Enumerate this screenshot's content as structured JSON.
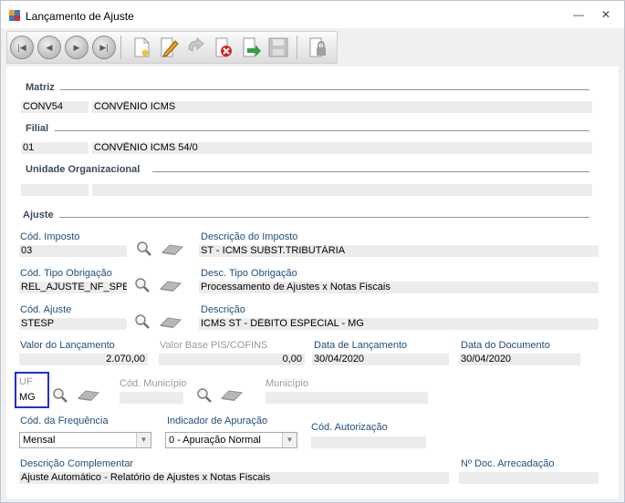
{
  "window": {
    "title": "Lançamento de Ajuste",
    "minimize": "—",
    "close": "✕"
  },
  "toolbar": {
    "buttons": [
      "first-icon",
      "previous-icon",
      "next-icon",
      "last-icon",
      "new-icon",
      "edit-icon",
      "undo-icon",
      "delete-icon",
      "confirm-icon",
      "save-icon",
      "lock-icon"
    ]
  },
  "matriz": {
    "section": "Matriz",
    "code": "CONV54",
    "name": "CONVÊNIO ICMS"
  },
  "filial": {
    "section": "Filial",
    "code": "01",
    "name": "CONVÊNIO ICMS 54/0"
  },
  "unidade": {
    "section": "Unidade Organizacional",
    "code": "",
    "name": ""
  },
  "ajuste": {
    "section": "Ajuste",
    "cod_imposto_label": "Cód. Imposto",
    "cod_imposto": "03",
    "desc_imposto_label": "Descrição do Imposto",
    "desc_imposto": "ST - ICMS SUBST.TRIBUTÁRIA",
    "cod_tipo_obrig_label": "Cód. Tipo Obrigação",
    "cod_tipo_obrig": "REL_AJUSTE_NF_SPEI",
    "desc_tipo_obrig_label": "Desc. Tipo Obrigação",
    "desc_tipo_obrig": "Processamento de Ajustes x Notas Fiscais",
    "cod_ajuste_label": "Cód. Ajuste",
    "cod_ajuste": "STESP",
    "descricao_label": "Descrição",
    "descricao": "ICMS ST - DÉBITO ESPECIAL - MG",
    "valor_lanc_label": "Valor do Lançamento",
    "valor_lanc": "2.070,00",
    "valor_base_label": "Valor Base PIS/COFINS",
    "valor_base": "0,00",
    "data_lanc_label": "Data de Lançamento",
    "data_lanc": "30/04/2020",
    "data_doc_label": "Data do Documento",
    "data_doc": "30/04/2020",
    "uf_label": "UF",
    "uf": "MG",
    "cod_municipio_label": "Cód. Município",
    "cod_municipio": "",
    "municipio_label": "Município",
    "municipio": "",
    "cod_frequencia_label": "Cód. da Frequência",
    "cod_frequencia": "Mensal",
    "indicador_label": "Indicador de Apuração",
    "indicador": "0 - Apuração Normal",
    "cod_autorizacao_label": "Cód. Autorização",
    "cod_autorizacao": "",
    "desc_complementar_label": "Descrição Complementar",
    "desc_complementar": "Ajuste Automático - Relatório de Ajustes x Notas Fiscais",
    "doc_arrecadacao_label": "Nº Doc. Arrecadação",
    "doc_arrecadacao": ""
  }
}
